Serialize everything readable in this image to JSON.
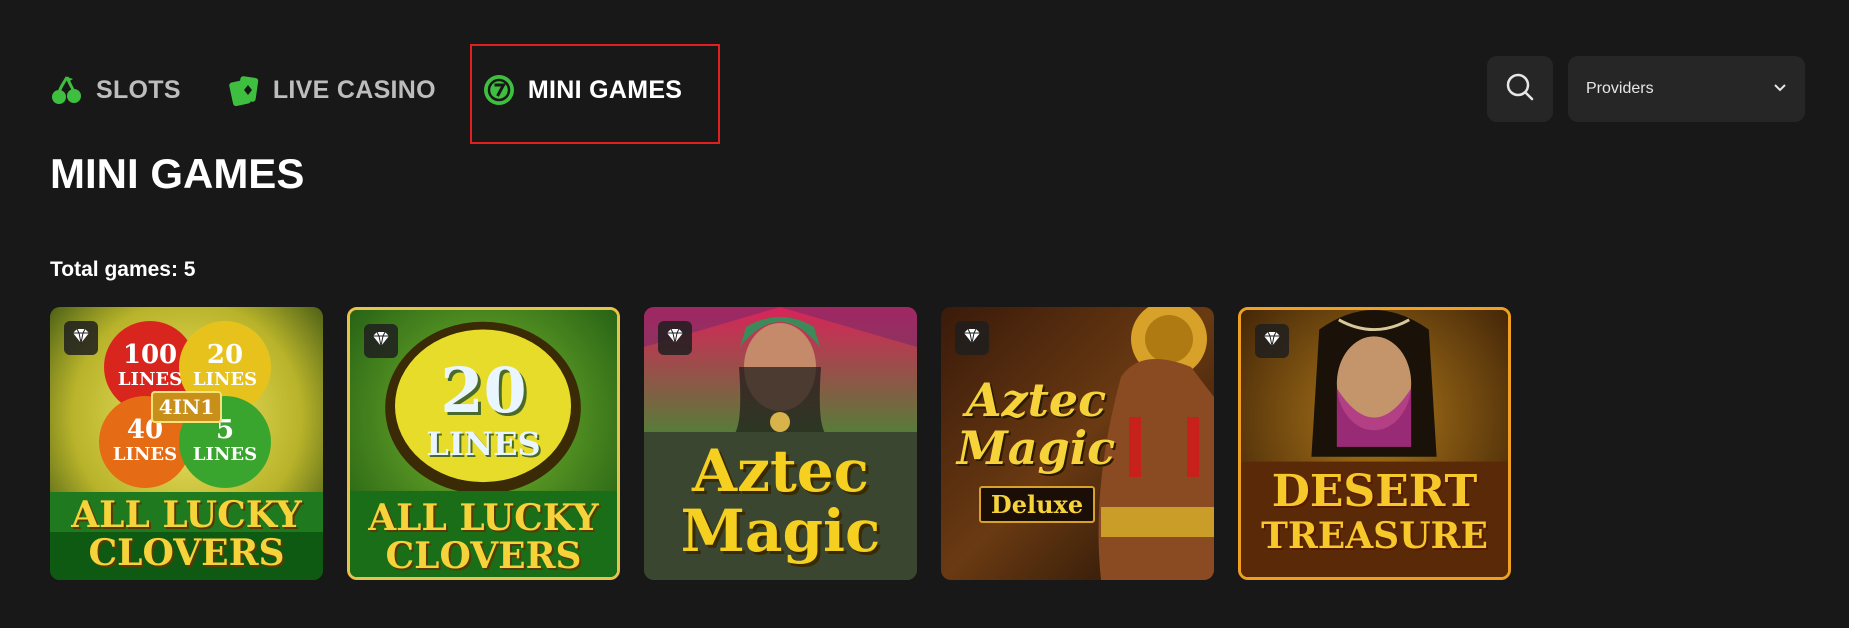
{
  "nav": {
    "tabs": [
      {
        "label": "SLOTS",
        "icon": "cherry-icon",
        "active": false
      },
      {
        "label": "LIVE CASINO",
        "icon": "cards-icon",
        "active": false
      },
      {
        "label": "MINI GAMES",
        "icon": "mini-games-icon",
        "active": true
      }
    ]
  },
  "search": {
    "icon": "search-icon"
  },
  "providers": {
    "label": "Providers",
    "icon": "chevron-down-icon"
  },
  "page_title": "MINI GAMES",
  "total_games_label": "Total games: 5",
  "games": [
    {
      "badge_icon": "diamond-icon",
      "text": {
        "c1": "100",
        "c1b": "LINES",
        "c2": "20",
        "c2b": "LINES",
        "c3": "40",
        "c3b": "LINES",
        "c4": "5",
        "c4b": "LINES",
        "center": "4IN1",
        "t1": "ALL LUCKY",
        "t2": "CLOVERS"
      }
    },
    {
      "badge_icon": "diamond-icon",
      "text": {
        "l1": "20",
        "l2": "LINES",
        "t1": "ALL LUCKY",
        "t2": "CLOVERS"
      }
    },
    {
      "badge_icon": "diamond-icon",
      "text": {
        "t1": "Aztec",
        "t2": "Magic"
      }
    },
    {
      "badge_icon": "diamond-icon",
      "text": {
        "t1": "Aztec",
        "t2": "Magic",
        "t3": "Deluxe"
      }
    },
    {
      "badge_icon": "diamond-icon",
      "text": {
        "t1": "DESERT",
        "t2": "TREASURE"
      }
    }
  ],
  "colors": {
    "accent": "#3fbf3f",
    "background": "#181818",
    "panel": "#262626",
    "highlight": "#e01f1f"
  }
}
